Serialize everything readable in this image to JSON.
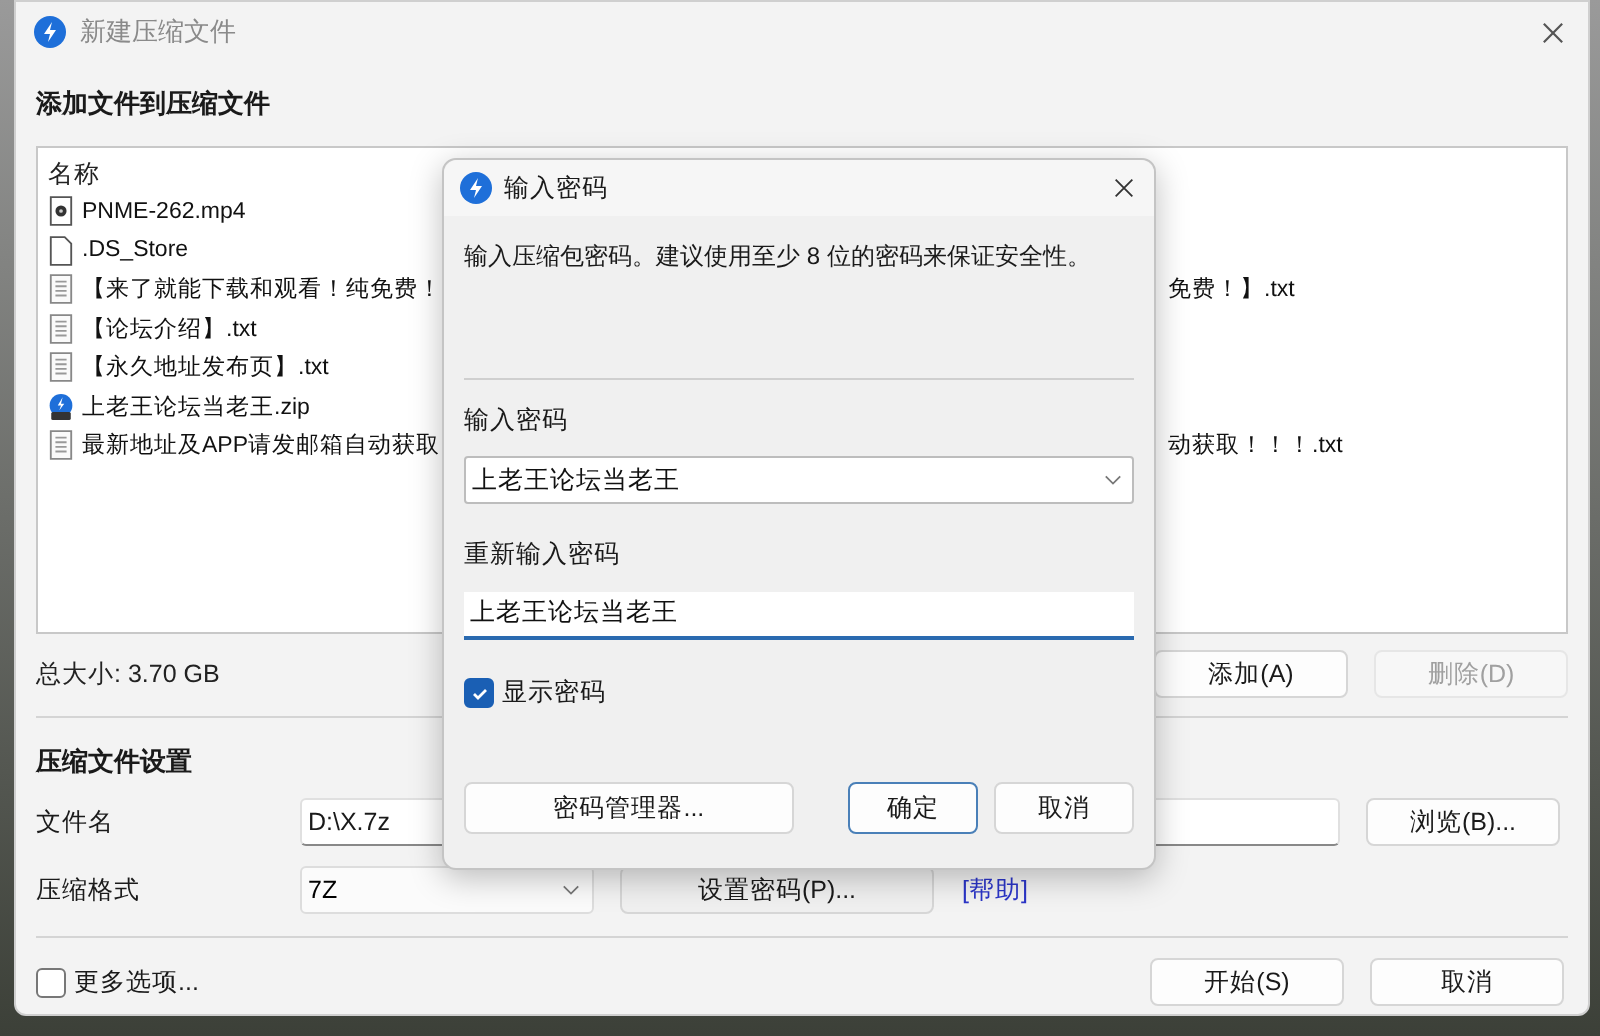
{
  "window": {
    "title": "新建压缩文件"
  },
  "files_section": {
    "heading": "添加文件到压缩文件",
    "column_header": "名称",
    "files": [
      {
        "kind": "video",
        "name": "PNME-262.mp4"
      },
      {
        "kind": "blank",
        "name": ".DS_Store"
      },
      {
        "kind": "text",
        "name": "【来了就能下载和观看！纯免费！",
        "name_right": "免费！】.txt"
      },
      {
        "kind": "text",
        "name": "【论坛介绍】.txt"
      },
      {
        "kind": "text",
        "name": "【永久地址发布页】.txt"
      },
      {
        "kind": "zip",
        "name": "上老王论坛当老王.zip"
      },
      {
        "kind": "text",
        "name": "最新地址及APP请发邮箱自动获取",
        "name_right": "动获取！！！.txt"
      }
    ],
    "total_size": "总大小: 3.70 GB",
    "buttons": [
      {
        "label": "添加(A)",
        "disabled": false
      },
      {
        "label": "删除(D)",
        "disabled": true
      }
    ]
  },
  "settings": {
    "heading": "压缩文件设置",
    "filename": {
      "label": "文件名",
      "value": "D:\\X.7z",
      "browse": "浏览(B)..."
    },
    "format": {
      "label": "压缩格式",
      "value": "7Z",
      "set_password": "设置密码(P)...",
      "help_link": "[帮助]"
    },
    "more_options": {
      "label": "更多选项...",
      "checked": false
    }
  },
  "buttons": [
    {
      "label": "开始(S)",
      "default": false
    },
    {
      "label": "取消",
      "default": false
    }
  ],
  "password_dialog": {
    "title": "输入密码",
    "description": "输入压缩包密码。建议使用至少 8 位的密码来保证安全性。",
    "password_label": "输入密码",
    "password_value": "上老王论坛当老王",
    "confirm_label": "重新输入密码",
    "confirm_value": "上老王论坛当老王",
    "show_password": {
      "label": "显示密码",
      "checked": true
    },
    "buttons": [
      {
        "label": "密码管理器...",
        "default": false
      },
      {
        "label": "确定",
        "default": true
      },
      {
        "label": "取消",
        "default": false
      }
    ]
  }
}
